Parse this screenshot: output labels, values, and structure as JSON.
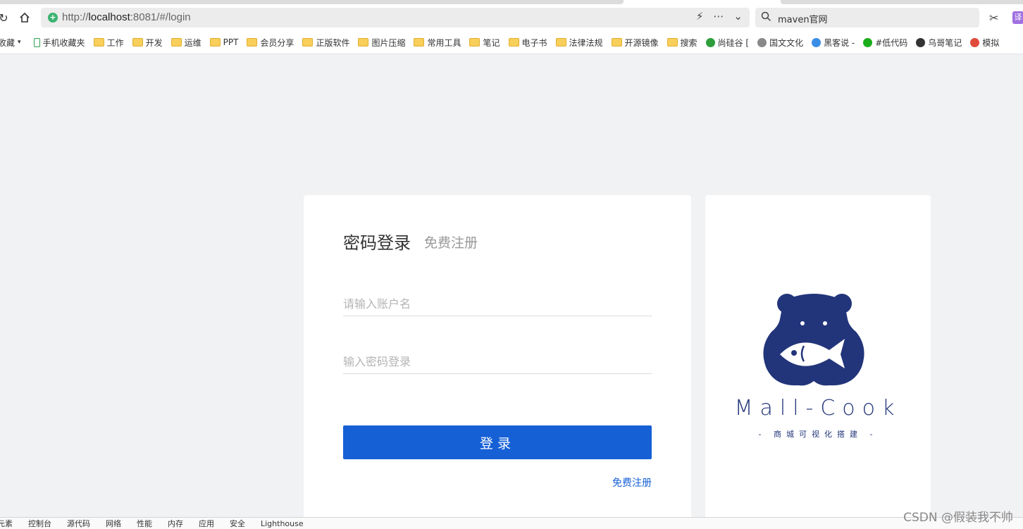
{
  "browser": {
    "url_host": "http://",
    "url_domain": "localhost",
    "url_rest": ":8081/#/login",
    "search_text": "maven官网",
    "translate_label": "译"
  },
  "bookmarks": [
    {
      "label": "收藏",
      "icon": "star-folder"
    },
    {
      "label": "手机收藏夹",
      "icon": "phone-icon"
    },
    {
      "label": "工作",
      "icon": "folder-icon"
    },
    {
      "label": "开发",
      "icon": "folder-icon"
    },
    {
      "label": "运维",
      "icon": "folder-icon"
    },
    {
      "label": "PPT",
      "icon": "folder-icon"
    },
    {
      "label": "会员分享",
      "icon": "folder-icon"
    },
    {
      "label": "正版软件",
      "icon": "folder-icon"
    },
    {
      "label": "图片压缩",
      "icon": "folder-icon"
    },
    {
      "label": "常用工具",
      "icon": "folder-icon"
    },
    {
      "label": "笔记",
      "icon": "folder-icon"
    },
    {
      "label": "电子书",
      "icon": "folder-icon"
    },
    {
      "label": "法律法规",
      "icon": "folder-icon"
    },
    {
      "label": "开源镜像",
      "icon": "folder-icon"
    },
    {
      "label": "搜索",
      "icon": "folder-icon"
    },
    {
      "label": "尚硅谷 [",
      "icon": "site-icon",
      "color": "#2e9e3c"
    },
    {
      "label": "国文文化",
      "icon": "site-icon",
      "color": "#888888"
    },
    {
      "label": "黑客说 -",
      "icon": "site-icon",
      "color": "#3a8ee6"
    },
    {
      "label": "#低代码",
      "icon": "site-icon",
      "color": "#1aad19"
    },
    {
      "label": "乌哥笔记",
      "icon": "site-icon",
      "color": "#333333"
    },
    {
      "label": "模拟",
      "icon": "site-icon",
      "color": "#e04a3a"
    }
  ],
  "login": {
    "title": "密码登录",
    "register_tab": "免费注册",
    "username_placeholder": "请输入账户名",
    "password_placeholder": "输入密码登录",
    "submit_label": "登录",
    "register_link": "免费注册"
  },
  "brand": {
    "name": "Mall-Cook",
    "slogan": "- 商城可视化搭建 -",
    "color": "#22357a"
  },
  "devtools_tabs": [
    "元素",
    "控制台",
    "源代码",
    "网络",
    "性能",
    "内存",
    "应用",
    "安全",
    "Lighthouse"
  ],
  "watermark": "CSDN @假装我不帅",
  "colors": {
    "primary": "#1660d6",
    "background": "#f1f2f4"
  }
}
